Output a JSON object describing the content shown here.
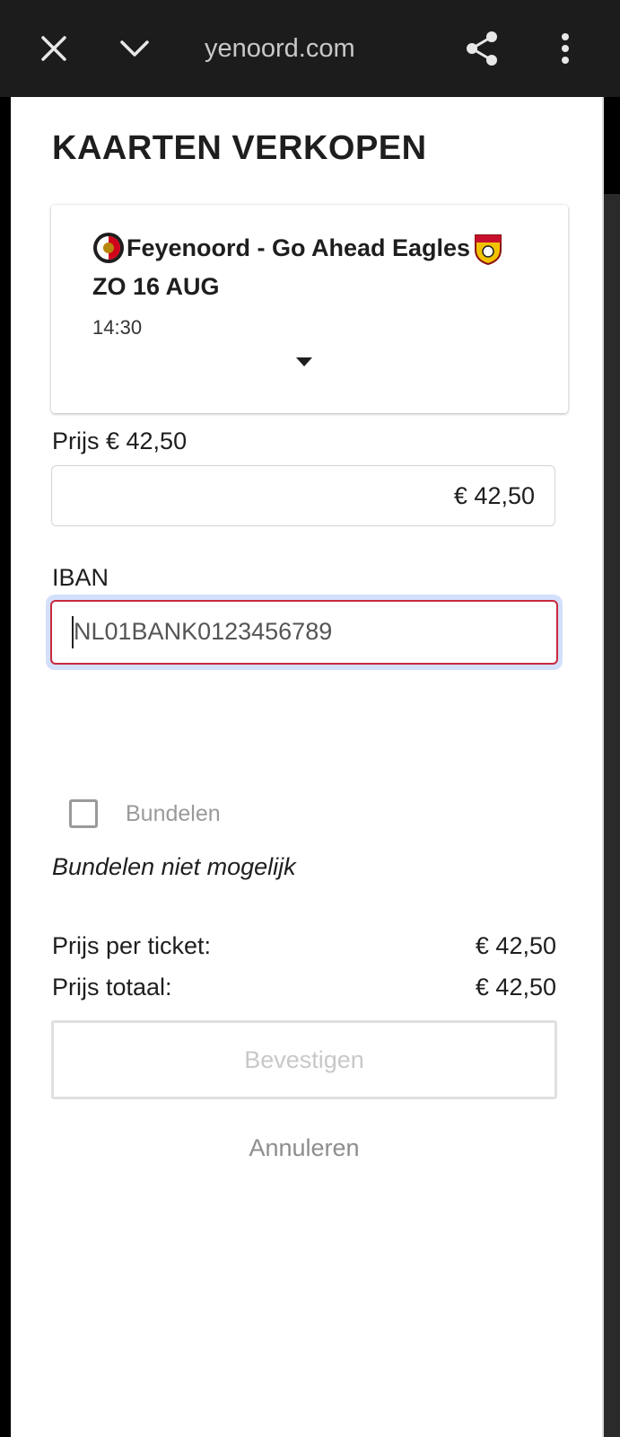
{
  "browser": {
    "url": "yenoord.com",
    "close_icon": "close-icon",
    "tabs_icon": "chevron-down-icon",
    "share_icon": "share-icon",
    "menu_icon": "more-vertical-icon"
  },
  "page": {
    "title": "KAARTEN VERKOPEN"
  },
  "match": {
    "name": "Feyenoord - Go Ahead Eagles",
    "date": "ZO 16 AUG",
    "time": "14:30",
    "home_logo": "feyenoord-logo-icon",
    "away_logo": "go-ahead-eagles-logo-icon"
  },
  "price": {
    "label": "Prijs € 42,50",
    "value": "€ 42,50"
  },
  "iban": {
    "label": "IBAN",
    "placeholder": "NL01BANK0123456789",
    "value": ""
  },
  "bundle": {
    "checkbox_label": "Bundelen",
    "checked": false,
    "note": "Bundelen niet mogelijk"
  },
  "summary": {
    "per_ticket_label": "Prijs per ticket:",
    "per_ticket_value": "€ 42,50",
    "total_label": "Prijs totaal:",
    "total_value": "€ 42,50"
  },
  "actions": {
    "confirm_label": "Bevestigen",
    "cancel_label": "Annuleren"
  },
  "colors": {
    "error_border": "#c9283e",
    "focus_glow": "#d3e0fb",
    "disabled_text": "#c8c8c8"
  }
}
